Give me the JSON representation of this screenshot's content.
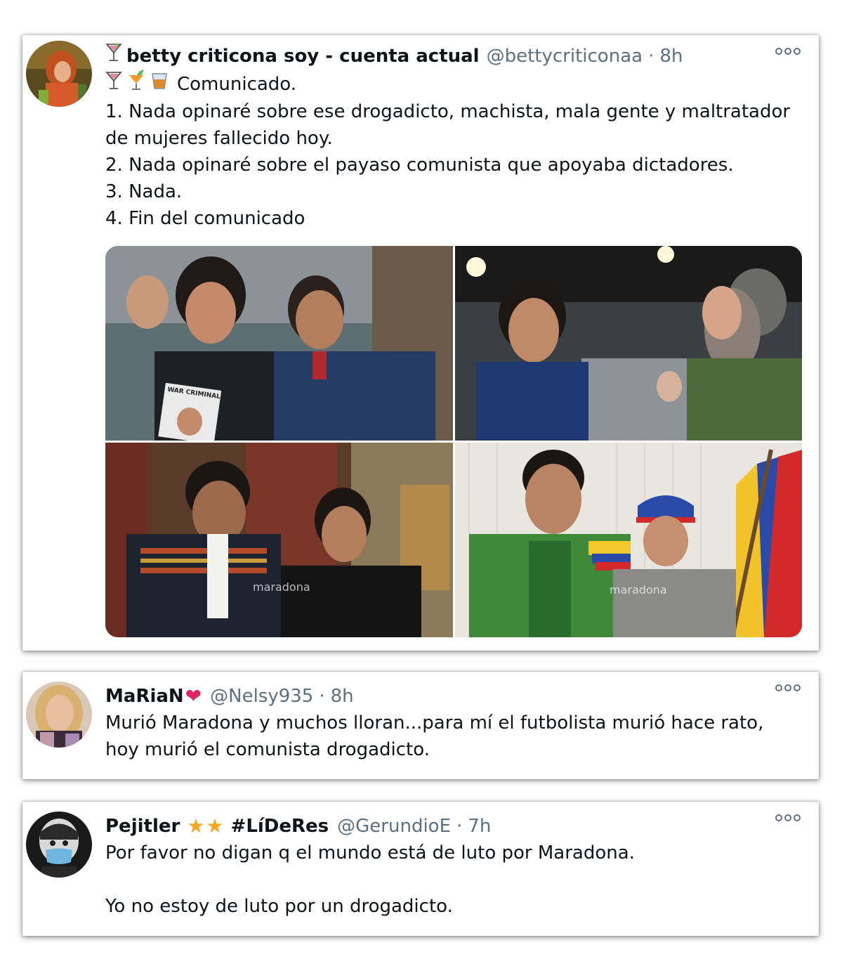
{
  "tweets": [
    {
      "name": "betty criticona soy - cuenta actual",
      "handle": "@bettycriticonaa",
      "separator": "·",
      "time": "8h",
      "name_prefix_icon": "cocktail-glass-emoji",
      "lines": [
        "Comunicado.",
        "1. Nada opinaré sobre ese drogadicto, machista, mala gente y maltratador de mujeres fallecido hoy.",
        "2. Nada opinaré sobre el payaso comunista que apoyaba dictadores.",
        "3. Nada.",
        "4. Fin del comunicado"
      ],
      "first_line_icons": [
        "cocktail-glass-emoji",
        "tropical-drink-emoji",
        "tumbler-glass-emoji"
      ],
      "photos": [
        {
          "alt": "Maradona laughing with Hugo Chávez",
          "badge": "WAR CRIMINAL"
        },
        {
          "alt": "Maradona with Fidel Castro"
        },
        {
          "alt": "Evo Morales with Maradona",
          "watermark": "maradona"
        },
        {
          "alt": "Nicolás Maduro with Maradona",
          "watermark": "maradona"
        }
      ]
    },
    {
      "name": "MaRiaN",
      "name_suffix_icon": "red-heart-emoji",
      "handle": "@Nelsy935",
      "separator": "·",
      "time": "8h",
      "lines": [
        "Murió Maradona y muchos lloran...para mí el futbolista murió hace rato, hoy murió el comunista drogadicto."
      ]
    },
    {
      "name": "Pejitler",
      "name_suffix_icons": [
        "star-emoji",
        "star-emoji"
      ],
      "name_suffix_text": "#LíDeRes",
      "handle": "@GerundioE",
      "separator": "·",
      "time": "7h",
      "lines": [
        "Por favor no digan q el mundo está de luto por Maradona.",
        "Yo no estoy de luto por un drogadicto."
      ]
    }
  ],
  "colors": {
    "text": "#0f1419",
    "secondary": "#5b7083",
    "heart": "#e0245e",
    "star": "#f5a623"
  }
}
